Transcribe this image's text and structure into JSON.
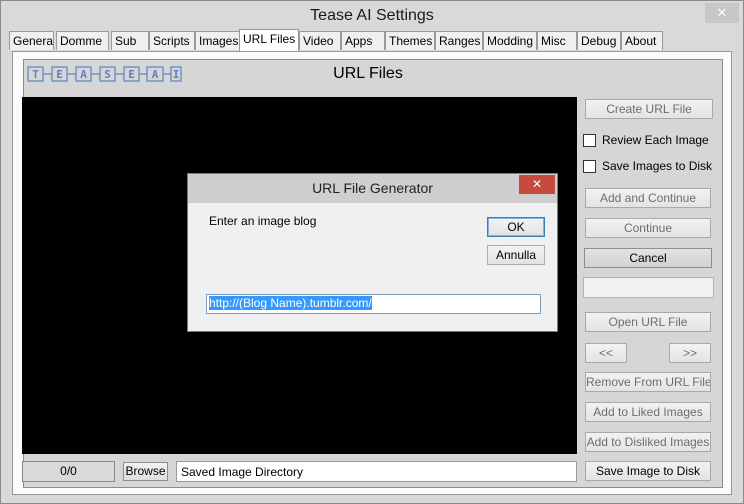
{
  "window": {
    "title": "Tease AI Settings",
    "close_glyph": "✕"
  },
  "tabs": [
    {
      "label": "General"
    },
    {
      "label": "Domme"
    },
    {
      "label": "Sub"
    },
    {
      "label": "Scripts"
    },
    {
      "label": "Images"
    },
    {
      "label": "URL Files",
      "active": true
    },
    {
      "label": "Video"
    },
    {
      "label": "Apps"
    },
    {
      "label": "Themes"
    },
    {
      "label": "Ranges"
    },
    {
      "label": "Modding"
    },
    {
      "label": "Misc"
    },
    {
      "label": "Debug"
    },
    {
      "label": "About"
    }
  ],
  "logo": {
    "letters": [
      "T",
      "E",
      "A",
      "S",
      "E",
      "A",
      "I"
    ],
    "color": "#5b82c4"
  },
  "panel": {
    "heading": "URL Files"
  },
  "sidebar": {
    "create_url_file": "Create URL File",
    "review_each_image": "Review Each Image",
    "save_images_to_disk": "Save Images to Disk",
    "add_and_continue": "Add and Continue",
    "continue": "Continue",
    "cancel": "Cancel",
    "open_url_file": "Open URL File",
    "prev": "<<",
    "next": ">>",
    "remove_from_url_file": "Remove From URL File",
    "add_to_liked_images": "Add to Liked Images",
    "add_to_disliked_images": "Add to Disliked Images",
    "save_image_to_disk": "Save Image to Disk"
  },
  "bottom": {
    "counter": "0/0",
    "browse": "Browse",
    "directory_value": "Saved Image Directory"
  },
  "dialog": {
    "title": "URL File Generator",
    "close_glyph": "✕",
    "prompt": "Enter an image blog",
    "ok": "OK",
    "cancel": "Annulla",
    "input_value": "http://(Blog Name).tumblr.com/"
  },
  "colors": {
    "dialog_close": "#c74a3f",
    "selection": "#3399ff",
    "viewer_bg": "#000000"
  }
}
